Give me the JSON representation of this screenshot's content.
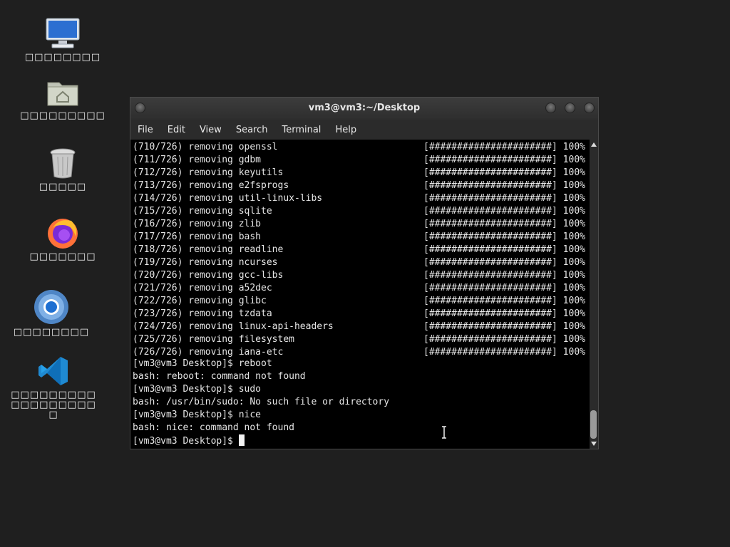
{
  "desktop": {
    "icons": [
      {
        "name": "computer",
        "label": "□□□□□□□□"
      },
      {
        "name": "home-folder",
        "label": "□□□□□□□□□"
      },
      {
        "name": "trash",
        "label": "□□□□□"
      },
      {
        "name": "firefox",
        "label": "□□□□□□□"
      },
      {
        "name": "chromium",
        "label": "□□□□□□□□"
      },
      {
        "name": "vscode",
        "label": "□□□□□□□□□□□□□□□□□□□"
      }
    ]
  },
  "window": {
    "title": "vm3@vm3:~/Desktop",
    "menu": [
      "File",
      "Edit",
      "View",
      "Search",
      "Terminal",
      "Help"
    ]
  },
  "terminal": {
    "progress_bar": "[######################]",
    "progress_pct": "100%",
    "progress_lines": [
      "(710/726) removing openssl",
      "(711/726) removing gdbm",
      "(712/726) removing keyutils",
      "(713/726) removing e2fsprogs",
      "(714/726) removing util-linux-libs",
      "(715/726) removing sqlite",
      "(716/726) removing zlib",
      "(717/726) removing bash",
      "(718/726) removing readline",
      "(719/726) removing ncurses",
      "(720/726) removing gcc-libs",
      "(721/726) removing a52dec",
      "(722/726) removing glibc",
      "(723/726) removing tzdata",
      "(724/726) removing linux-api-headers",
      "(725/726) removing filesystem",
      "(726/726) removing iana-etc"
    ],
    "tail_lines": [
      "[vm3@vm3 Desktop]$ reboot",
      "bash: reboot: command not found",
      "[vm3@vm3 Desktop]$ sudo",
      "bash: /usr/bin/sudo: No such file or directory",
      "[vm3@vm3 Desktop]$ nice",
      "bash: nice: command not found"
    ],
    "prompt": "[vm3@vm3 Desktop]$ "
  }
}
